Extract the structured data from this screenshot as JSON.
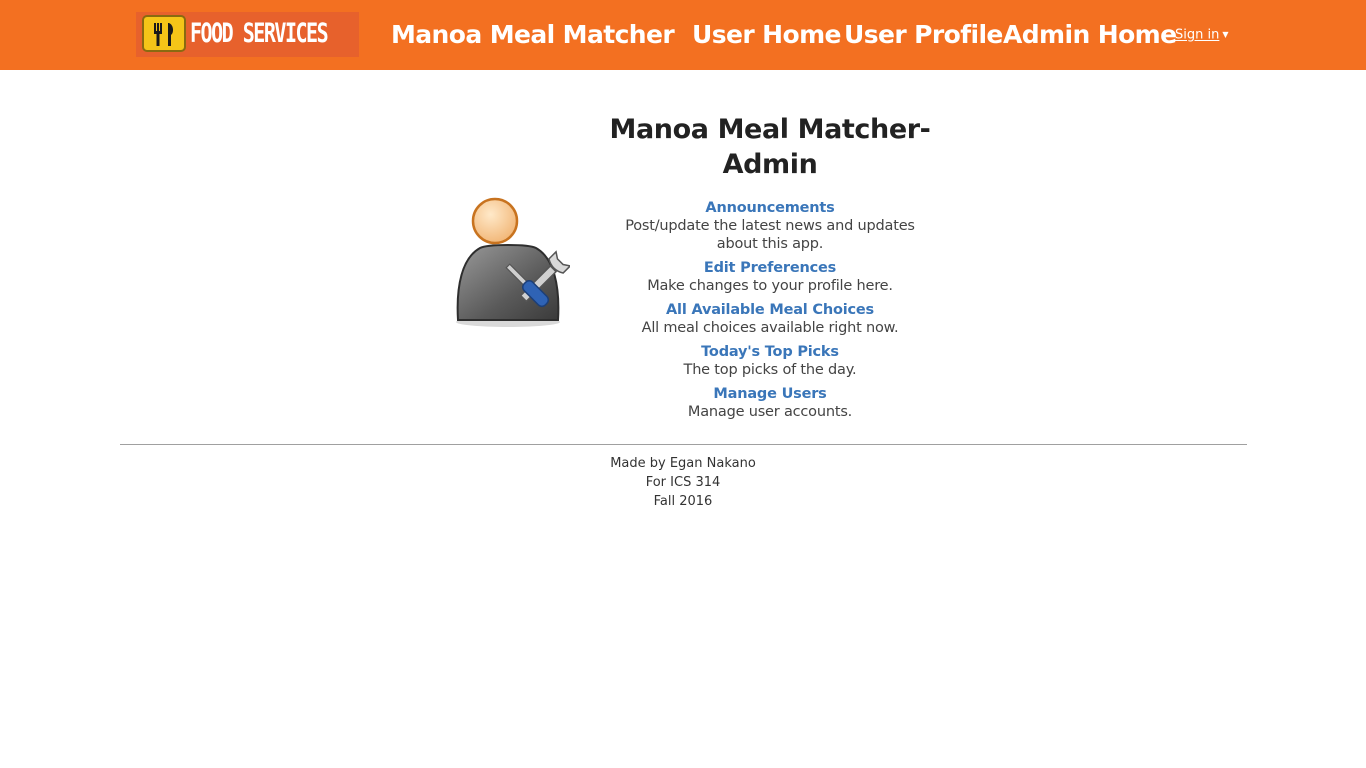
{
  "navbar": {
    "logo_text": "FOOD SERVICES",
    "brand": "Manoa Meal Matcher",
    "links": [
      "User Home",
      "User Profile",
      "Admin Home"
    ],
    "signin": "Sign in",
    "caret_icon": "caret-down-icon",
    "bg_color": "#f37021"
  },
  "main": {
    "title": "Manoa Meal Matcher-Admin",
    "avatar_icon": "admin-user-icon",
    "items": [
      {
        "label": "Announcements",
        "desc": "Post/update the latest news and updates about this app."
      },
      {
        "label": "Edit Preferences",
        "desc": "Make changes to your profile here."
      },
      {
        "label": "All Available Meal Choices",
        "desc": "All meal choices available right now."
      },
      {
        "label": "Today's Top Picks",
        "desc": "The top picks of the day."
      },
      {
        "label": "Manage Users",
        "desc": "Manage user accounts."
      }
    ],
    "link_color": "#3a76b9"
  },
  "footer": {
    "lines": [
      "Made by Egan Nakano",
      "For ICS 314",
      "Fall 2016"
    ]
  }
}
